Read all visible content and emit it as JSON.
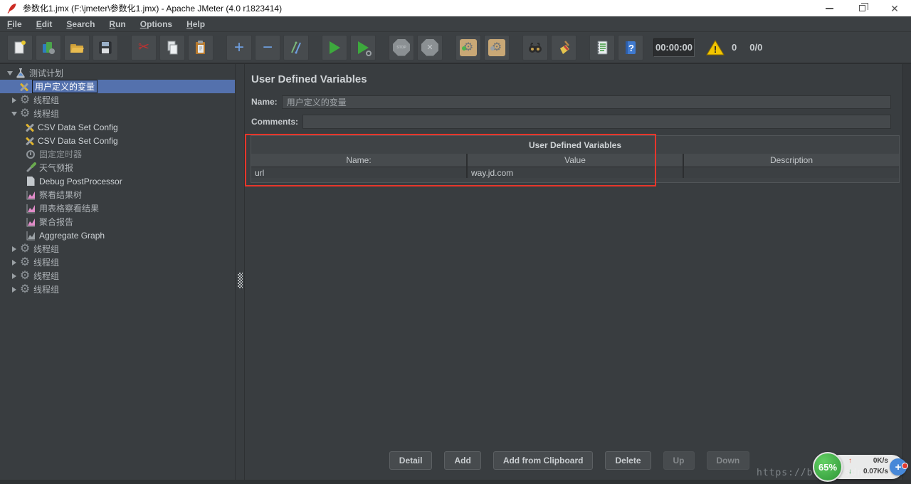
{
  "window": {
    "title": "参数化1.jmx (F:\\jmeter\\参数化1.jmx) - Apache JMeter (4.0 r1823414)"
  },
  "menu": {
    "items": [
      "File",
      "Edit",
      "Search",
      "Run",
      "Options",
      "Help"
    ]
  },
  "toolbar": {
    "buttons": [
      "new-file",
      "templates",
      "open",
      "save",
      "cut",
      "copy",
      "paste",
      "zoom-in",
      "zoom-out",
      "toggle",
      "start",
      "start-no-pauses",
      "stop",
      "shutdown",
      "remote-start-all",
      "remote-shutdown-all",
      "search",
      "clear-all",
      "function-helper",
      "help"
    ],
    "timer": "00:00:00",
    "warning_count": "0",
    "thread_count": "0/0",
    "stop_label": "STOP"
  },
  "tree": {
    "items": [
      {
        "label": "测试计划",
        "icon": "flask",
        "state": "expanded"
      },
      {
        "label": "用户定义的变量",
        "icon": "tools",
        "selected": true
      },
      {
        "label": "线程组",
        "icon": "gear",
        "state": "collapsed"
      },
      {
        "label": "线程组",
        "icon": "gear",
        "state": "expanded"
      },
      {
        "label": "CSV Data Set Config",
        "icon": "tools"
      },
      {
        "label": "CSV Data Set Config",
        "icon": "tools"
      },
      {
        "label": "固定定时器",
        "icon": "clock"
      },
      {
        "label": "天气预报",
        "icon": "pipette"
      },
      {
        "label": "Debug PostProcessor",
        "icon": "document"
      },
      {
        "label": "察看结果树",
        "icon": "chart-pink"
      },
      {
        "label": "用表格察看结果",
        "icon": "chart-pink"
      },
      {
        "label": "聚合报告",
        "icon": "chart-pink"
      },
      {
        "label": "Aggregate Graph",
        "icon": "chart-grey"
      },
      {
        "label": "线程组",
        "icon": "gear",
        "state": "collapsed"
      },
      {
        "label": "线程组",
        "icon": "gear",
        "state": "collapsed"
      },
      {
        "label": "线程组",
        "icon": "gear",
        "state": "collapsed"
      },
      {
        "label": "线程组",
        "icon": "gear",
        "state": "collapsed"
      }
    ]
  },
  "main": {
    "title": "User Defined Variables",
    "name_label": "Name:",
    "name_value": "用户定义的变量",
    "comments_label": "Comments:",
    "comments_value": "",
    "table": {
      "title": "User Defined Variables",
      "columns": [
        "Name:",
        "Value",
        "Description"
      ],
      "rows": [
        [
          "url",
          "way.jd.com",
          ""
        ]
      ]
    },
    "buttons": [
      {
        "label": "Detail",
        "enabled": true
      },
      {
        "label": "Add",
        "enabled": true
      },
      {
        "label": "Add from Clipboard",
        "enabled": true
      },
      {
        "label": "Delete",
        "enabled": true
      },
      {
        "label": "Up",
        "enabled": false
      },
      {
        "label": "Down",
        "enabled": false
      }
    ]
  },
  "overlay": {
    "watermark": "https://blog.csdn.net/",
    "progress_percent": "65%",
    "upload_speed": "0K/s",
    "download_speed": "0.07K/s"
  },
  "colors": {
    "selection_blue": "#5471ad",
    "annotation_red": "#e8362b",
    "progress_green": "#2e9637",
    "warning_yellow": "#f2c500",
    "panel_bg": "#393d40",
    "titlebar_bg": "#ffffff"
  }
}
